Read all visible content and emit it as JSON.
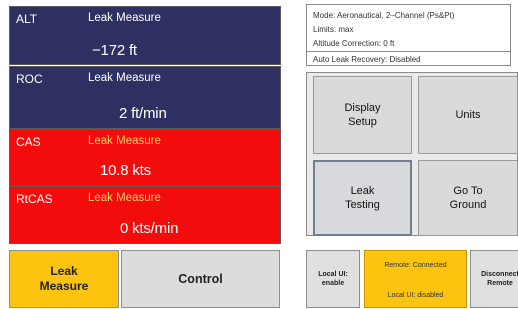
{
  "panels": [
    {
      "name": "ALT",
      "mode": "Leak Measure",
      "value": "−172 ft"
    },
    {
      "name": "ROC",
      "mode": "Leak Measure",
      "value": "2 ft/min"
    },
    {
      "name": "CAS",
      "mode": "Leak Measure",
      "value": "10.8 kts"
    },
    {
      "name": "RtCAS",
      "mode": "Leak Measure",
      "value": "0 kts/min"
    }
  ],
  "buttons": {
    "leak_measure": "Leak\nMeasure",
    "control": "Control"
  },
  "status": {
    "mode": "Mode: Aeronautical, 2–Channel (Ps&Pt)",
    "limits": "Limits: max",
    "altitude_correction": "Altitude Correction: 0 ft",
    "auto_leak_recovery": "Auto Leak Recovery: Disabled"
  },
  "menu": {
    "display_setup": "Display\nSetup",
    "units": "Units",
    "leak_testing": "Leak\nTesting",
    "go_to_ground": "Go To\nGround"
  },
  "footer": {
    "local_ui": "Local UI:\nenable",
    "remote_line1": "Remote: Connected",
    "remote_line2": "Local UI: disabled",
    "disconnect": "Disconnect\nRemote"
  },
  "colors": {
    "panel_blue": "#2f3062",
    "panel_red": "#f20c0c",
    "active_yellow": "#fcc30f"
  }
}
